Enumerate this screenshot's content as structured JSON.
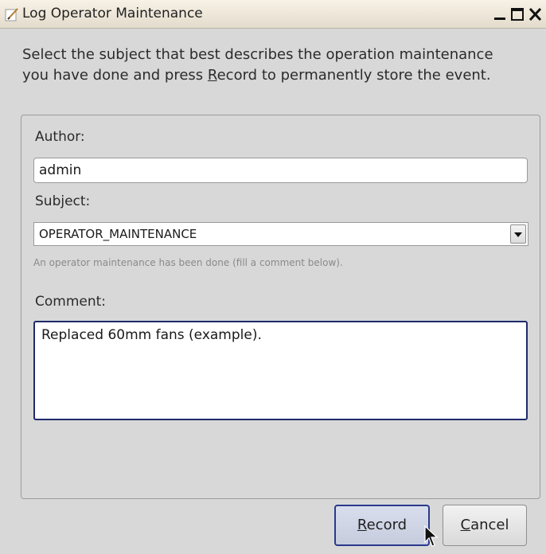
{
  "window": {
    "title": "Log Operator Maintenance",
    "icon": "edit-pen-icon",
    "controls": [
      "minimize-icon",
      "maximize-icon",
      "close-icon"
    ]
  },
  "intro": {
    "line1": "Select the subject that best describes the operation maintenance",
    "line2_before": "you have done and press ",
    "line2_mnemonic": "R",
    "line2_after": "ecord to permanently store the event."
  },
  "form": {
    "author_label": "Author:",
    "author_value": "admin",
    "subject_label": "Subject:",
    "subject_value": "OPERATOR_MAINTENANCE",
    "subject_hint": "An operator maintenance has been done (fill a comment below).",
    "comment_label": "Comment:",
    "comment_value": "Replaced 60mm fans (example)."
  },
  "buttons": {
    "record_mnemonic": "R",
    "record_rest": "ecord",
    "cancel_mnemonic": "C",
    "cancel_rest": "ancel"
  },
  "colors": {
    "focus_border": "#1f2a6b",
    "default_button_border": "#2a3a8c",
    "background": "#d8d8d8"
  }
}
